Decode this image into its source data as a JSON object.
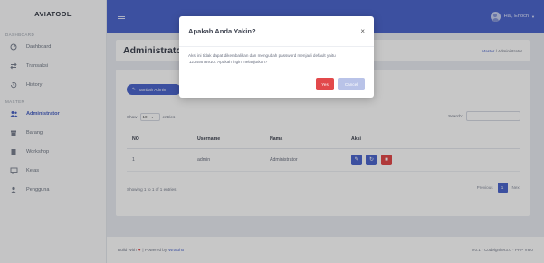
{
  "app": {
    "brand": "AVIATOOL"
  },
  "sidebar": {
    "section_main": "DASHBOARD",
    "section_master": "MASTER",
    "items": [
      {
        "label": "Dashboard",
        "icon": "dashboard-icon"
      },
      {
        "label": "Transaksi",
        "icon": "exchange-icon"
      },
      {
        "label": "History",
        "icon": "history-icon"
      },
      {
        "label": "Administrator",
        "icon": "users-icon",
        "active": true
      },
      {
        "label": "Barang",
        "icon": "archive-icon"
      },
      {
        "label": "Workshop",
        "icon": "building-icon"
      },
      {
        "label": "Kelas",
        "icon": "chalkboard-icon"
      },
      {
        "label": "Pengguna",
        "icon": "user-icon"
      }
    ]
  },
  "topbar": {
    "user_name": "Hai, Enoch"
  },
  "header": {
    "title": "Administrator",
    "breadcrumb_home": "Master",
    "breadcrumb_sep": "/",
    "breadcrumb_current": "Administrator"
  },
  "main": {
    "add_button": "Tambah Admin",
    "show_label": "Show",
    "entries_value": "10",
    "entries_label": "entries",
    "search_label": "Search:",
    "columns": [
      "NO",
      "Username",
      "Nama",
      "Aksi"
    ],
    "rows": [
      {
        "no": "1",
        "username": "admin",
        "nama": "Administrator"
      }
    ],
    "info": "Showing 1 to 1 of 1 entries",
    "pager": {
      "previous": "Previous",
      "current": "1",
      "next": "Next"
    }
  },
  "footer": {
    "built_with": "Build With",
    "powered": "| Powered by",
    "brand": "Wrastho",
    "version": "V0.1 · Codeigniter3.0 · PHP V8.0"
  },
  "modal": {
    "title": "Apakah Anda Yakin?",
    "close": "×",
    "body": "Aksi ini tidak dapat dikembalikan dan mengubah password menjadi default yaitu '12345678910'. Apakah ingin melanjutkan?",
    "yes": "Yes",
    "cancel": "Cancel"
  },
  "colors": {
    "primary": "#4e67cd",
    "danger": "#e2494b"
  }
}
